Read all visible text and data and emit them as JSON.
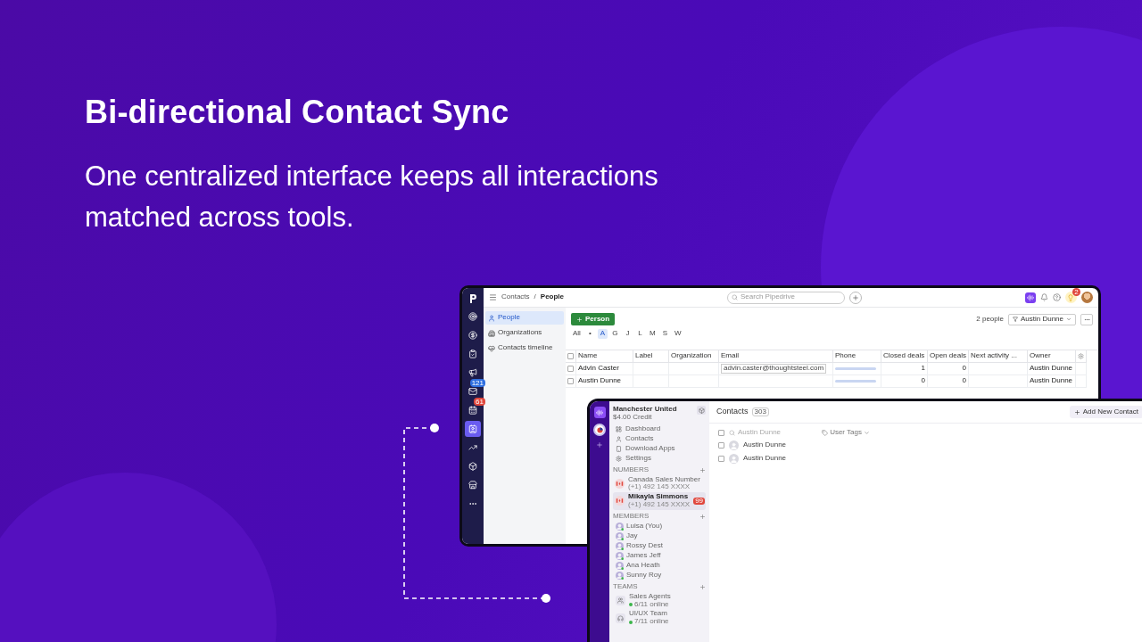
{
  "headline": "Bi-directional Contact Sync",
  "subtitle": "One centralized interface keeps all interactions matched across tools.",
  "crm_window": {
    "nav_icons": [
      {
        "kind": "target",
        "selected": false
      },
      {
        "kind": "deals",
        "selected": false
      },
      {
        "kind": "tasks",
        "selected": false
      },
      {
        "kind": "campaigns",
        "selected": false
      },
      {
        "kind": "mail",
        "selected": false,
        "badge": {
          "text": "121",
          "color": "#2f6fe0"
        }
      },
      {
        "kind": "calendar",
        "selected": false,
        "badge": {
          "text": "61",
          "color": "#e0473d"
        }
      },
      {
        "kind": "contacts",
        "selected": true
      },
      {
        "kind": "insights",
        "selected": false
      },
      {
        "kind": "products",
        "selected": false
      },
      {
        "kind": "marketplace",
        "selected": false
      },
      {
        "kind": "more",
        "selected": false
      }
    ],
    "breadcrumb": {
      "parent": "Contacts",
      "separator": "/",
      "current": "People"
    },
    "search": {
      "placeholder": "Search Pipedrive"
    },
    "notification_badge": "2",
    "side_items": [
      {
        "kind": "person",
        "label": "People",
        "selected": true
      },
      {
        "kind": "building",
        "label": "Organizations",
        "selected": false
      },
      {
        "kind": "timeline",
        "label": "Contacts timeline",
        "selected": false
      }
    ],
    "add_button": "Person",
    "count": "2 people",
    "filter": "Austin Dunne",
    "letters": [
      {
        "label": "All",
        "selected": false
      },
      {
        "label": "•",
        "selected": false
      },
      {
        "label": "A",
        "selected": true
      },
      {
        "label": "G",
        "selected": false
      },
      {
        "label": "J",
        "selected": false
      },
      {
        "label": "L",
        "selected": false
      },
      {
        "label": "M",
        "selected": false
      },
      {
        "label": "S",
        "selected": false
      },
      {
        "label": "W",
        "selected": false
      }
    ],
    "select_all_checked": false,
    "columns": [
      "Name",
      "Label",
      "Organization",
      "Email",
      "Phone",
      "Closed deals",
      "Open deals",
      "Next activity ...",
      "Owner"
    ],
    "rows": [
      {
        "checked": false,
        "name": "Advin Caster",
        "email": "advin.caster@thoughtsteel.com",
        "closed_deals": "1",
        "open_deals": "0",
        "owner": "Austin Dunne"
      },
      {
        "checked": false,
        "name": "Austin Dunne",
        "closed_deals": "0",
        "open_deals": "0",
        "owner": "Austin Dunne"
      }
    ]
  },
  "phone_window": {
    "workspace": "Manchester United",
    "credit": "$4.00 Credit",
    "nav": [
      {
        "kind": "dashboard",
        "label": "Dashboard"
      },
      {
        "kind": "contacts",
        "label": "Contacts"
      },
      {
        "kind": "download",
        "label": "Download Apps"
      },
      {
        "kind": "settings",
        "label": "Settings"
      }
    ],
    "numbers_heading": "NUMBERS",
    "numbers": [
      {
        "name": "Canada Sales Number",
        "phone": "(+1) 492 145 XXXX",
        "selected": false
      },
      {
        "name": "Mikayla Simmons",
        "phone": "(+1) 492 145 XXXX",
        "selected": true,
        "badge": "99"
      }
    ],
    "members_heading": "MEMBERS",
    "members": [
      {
        "name": "Luisa (You)"
      },
      {
        "name": "Jay"
      },
      {
        "name": "Rossy Dest"
      },
      {
        "name": "James Jeff"
      },
      {
        "name": "Ana Heath"
      },
      {
        "name": "Sunny Roy"
      }
    ],
    "teams_heading": "TEAMS",
    "teams": [
      {
        "kind": "agents",
        "name": "Sales Agents",
        "status": "6/11 online"
      },
      {
        "kind": "headset",
        "name": "UI/UX Team",
        "status": "7/11 online"
      }
    ],
    "title": "Contacts",
    "total": "303",
    "select_all_checked": false,
    "search": {
      "placeholder": "Austin Dunne"
    },
    "tags": "User Tags",
    "add_button": "Add New Contact",
    "contacts": [
      {
        "name": "Austin Dunne",
        "checked": false
      },
      {
        "name": "Austin Dunne",
        "checked": false
      }
    ]
  }
}
